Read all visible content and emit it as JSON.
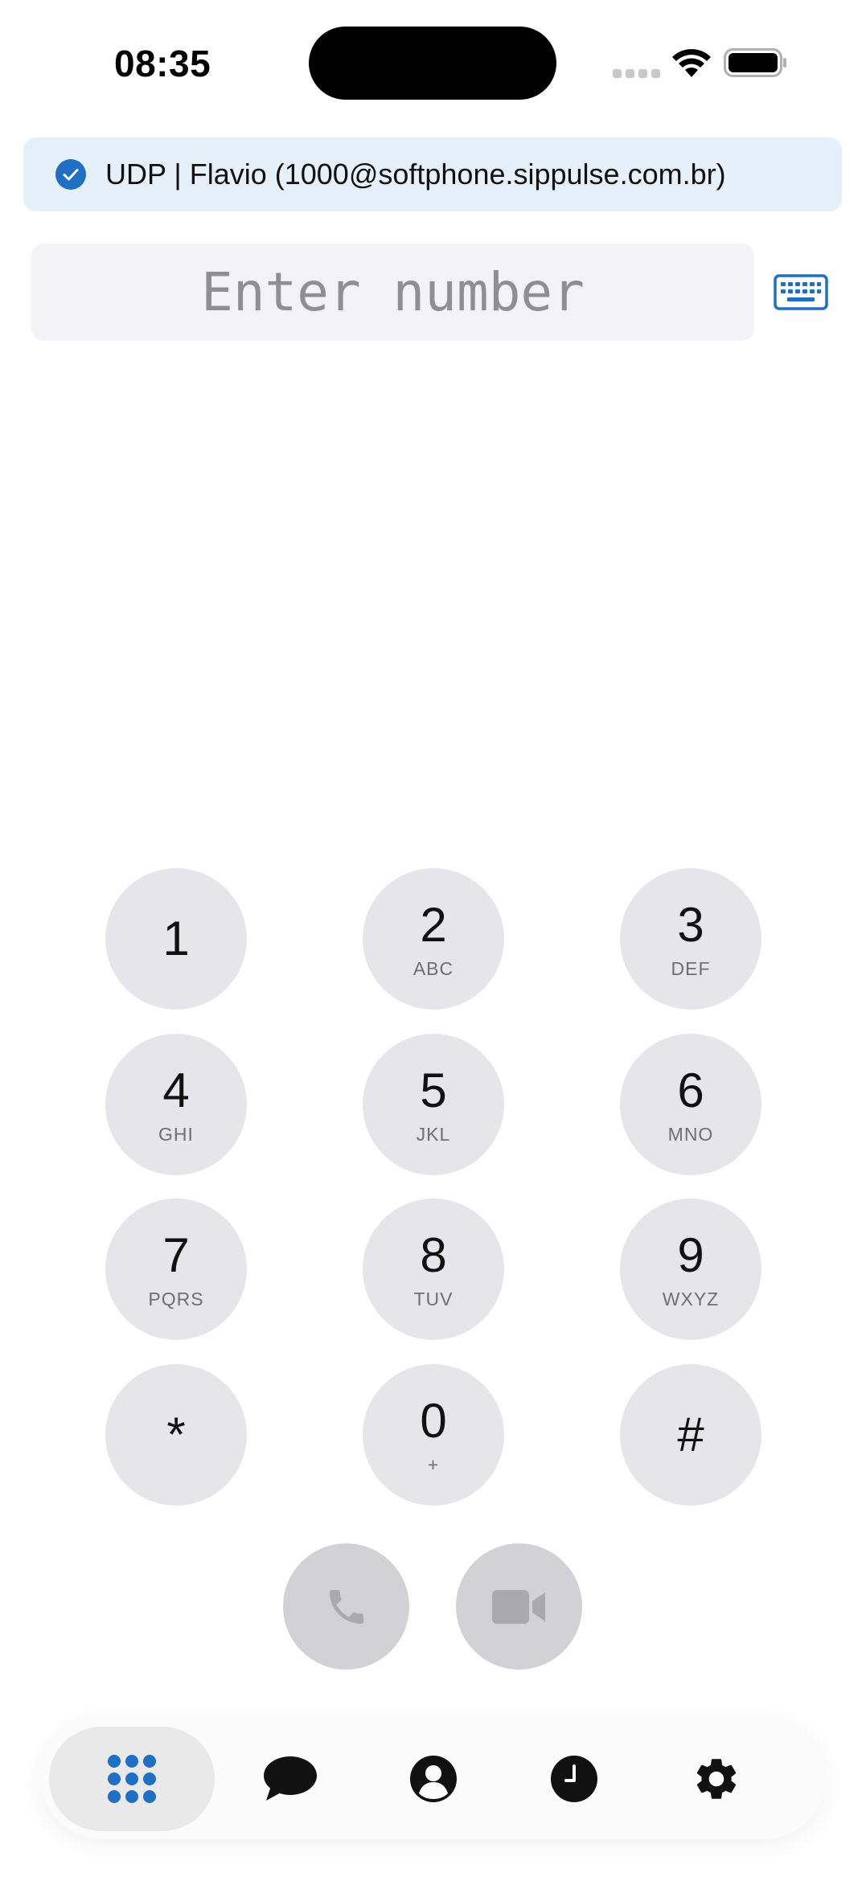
{
  "status_bar": {
    "time": "08:35"
  },
  "account": {
    "label": "UDP | Flavio (1000@softphone.sippulse.com.br)",
    "status_icon": "check-circle-icon",
    "accent_color": "#1f6fc5"
  },
  "dial_input": {
    "value": "",
    "placeholder": "Enter number"
  },
  "keypad": [
    {
      "digit": "1",
      "letters": ""
    },
    {
      "digit": "2",
      "letters": "ABC"
    },
    {
      "digit": "3",
      "letters": "DEF"
    },
    {
      "digit": "4",
      "letters": "GHI"
    },
    {
      "digit": "5",
      "letters": "JKL"
    },
    {
      "digit": "6",
      "letters": "MNO"
    },
    {
      "digit": "7",
      "letters": "PQRS"
    },
    {
      "digit": "8",
      "letters": "TUV"
    },
    {
      "digit": "9",
      "letters": "WXYZ"
    },
    {
      "digit": "*",
      "letters": ""
    },
    {
      "digit": "0",
      "letters": "+"
    },
    {
      "digit": "#",
      "letters": ""
    }
  ],
  "call_buttons": [
    {
      "icon": "phone-icon"
    },
    {
      "icon": "video-camera-icon"
    }
  ],
  "tab_bar": {
    "active_tab": "dialpad",
    "tabs": [
      {
        "id": "dialpad",
        "icon": "dialpad-icon"
      },
      {
        "id": "messages",
        "icon": "chat-bubble-icon"
      },
      {
        "id": "contacts",
        "icon": "contact-icon"
      },
      {
        "id": "history",
        "icon": "clock-icon"
      },
      {
        "id": "settings",
        "icon": "gear-icon"
      }
    ]
  }
}
